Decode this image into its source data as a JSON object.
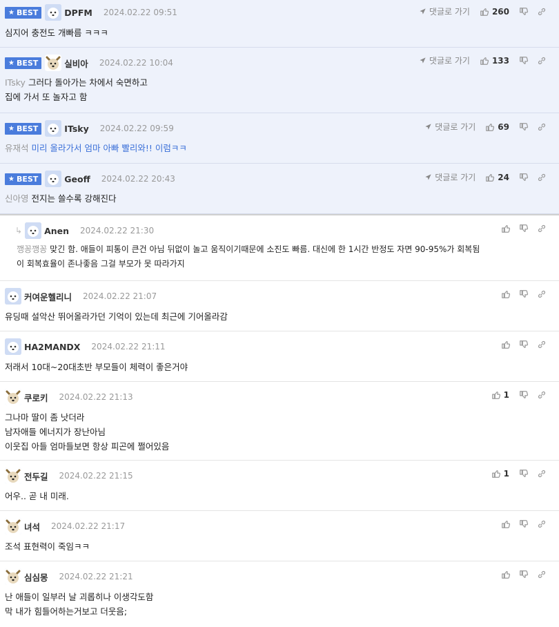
{
  "ui": {
    "best_label": "BEST",
    "goto_reply_label": "댓글로 가기"
  },
  "colors": {
    "best_badge": "#4a7cdc",
    "best_bg": "#eef2fb",
    "accent_text": "#3a6fd8"
  },
  "comments": [
    {
      "best": true,
      "nick": "DPFM",
      "time": "2024.02.22 09:51",
      "likes": "260",
      "mention": "",
      "text": "심지어 충전도 개빠름 ㅋㅋㅋ"
    },
    {
      "best": true,
      "nick": "실비아",
      "time": "2024.02.22 10:04",
      "likes": "133",
      "mention": "ITsky",
      "text": "그러다 돌아가는 차에서 숙면하고\n집에 가서 또 놀자고 함"
    },
    {
      "best": true,
      "nick": "ITsky",
      "time": "2024.02.22 09:59",
      "likes": "69",
      "mention": "유재석",
      "text": "미리 올라가서 엄마 아빠 빨리와!! 이럼ㅋㅋ"
    },
    {
      "best": true,
      "nick": "Geoff",
      "time": "2024.02.22 20:43",
      "likes": "24",
      "mention": "신아영",
      "text": "전지는 쓸수록 강해진다"
    },
    {
      "reply": true,
      "nick": "Anen",
      "time": "2024.02.22 21:30",
      "mention": "깽꽁깽꽁",
      "text": "맞긴 함. 애들이 피통이 큰건 아님 뒤없이 놀고 움직이기때문에 소진도 빠름. 대신에 한 1시간 반정도 자면 90-95%가 회복됨\n이 회복효율이 존나좋음 그걸 부모가 못 따라가지"
    },
    {
      "nick": "커여운헬리니",
      "time": "2024.02.22 21:07",
      "text": "유딩때 설악산 뛰어올라가던 기억이 있는데 최근에 기어올라감"
    },
    {
      "nick": "HA2MANDX",
      "time": "2024.02.22 21:11",
      "text": "저래서 10대~20대초반 부모들이 체력이 좋은거야"
    },
    {
      "nick": "쿠로키",
      "time": "2024.02.22 21:13",
      "likes": "1",
      "text": "그나마 딸이 좀 낫더라\n남자애들 에너지가 장난아님\n이웃집 아들 엄마들보면 항상 피곤에 쩔어있음"
    },
    {
      "nick": "전두길",
      "time": "2024.02.22 21:15",
      "likes": "1",
      "text": "어우.. 곧 내 미래."
    },
    {
      "nick": "녀석",
      "time": "2024.02.22 21:17",
      "text": "조석 표현력이 죽임ㅋㅋ"
    },
    {
      "nick": "심심몽",
      "time": "2024.02.22 21:21",
      "text": "난 애들이 일부러 날 괴롭히나 이생각도함\n막 내가 힘들어하는거보고 더웃음;"
    }
  ]
}
